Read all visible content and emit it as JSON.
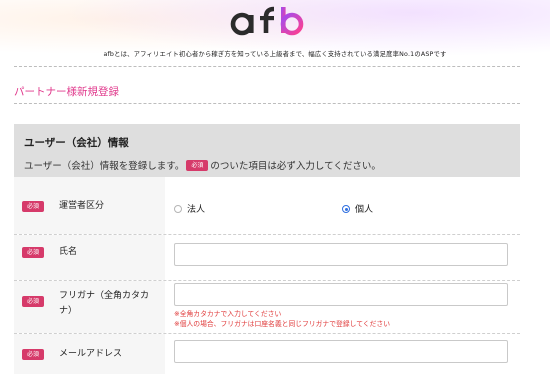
{
  "brand": {
    "logo_text": "afb",
    "tagline": "afbとは、アフィリエイト初心者から稼ぎ方を知っている上級者まで、幅広く支持されている満足度率No.1のASPです",
    "accent_color": "#e0398c",
    "badge_color": "#d63a6a"
  },
  "page": {
    "title": "パートナー様新規登録"
  },
  "section": {
    "title": "ユーザー（会社）情報",
    "desc_prefix": "ユーザー（会社）情報を登録します。",
    "desc_badge": "必須",
    "desc_suffix": "のついた項目は必ず入力してください。"
  },
  "form": {
    "required_label": "必須",
    "operator_type": {
      "label": "運営者区分",
      "options": [
        {
          "label": "法人",
          "checked": false
        },
        {
          "label": "個人",
          "checked": true
        }
      ]
    },
    "name": {
      "label": "氏名",
      "value": ""
    },
    "furigana": {
      "label_line1": "フリガナ（全角カタカ",
      "label_line2": "ナ）",
      "value": "",
      "note1": "※全角カタカナで入力してください",
      "note2": "※個人の場合、フリガナは口座名義と同じフリガナで登録してください"
    },
    "email": {
      "label": "メールアドレス",
      "value": ""
    }
  }
}
